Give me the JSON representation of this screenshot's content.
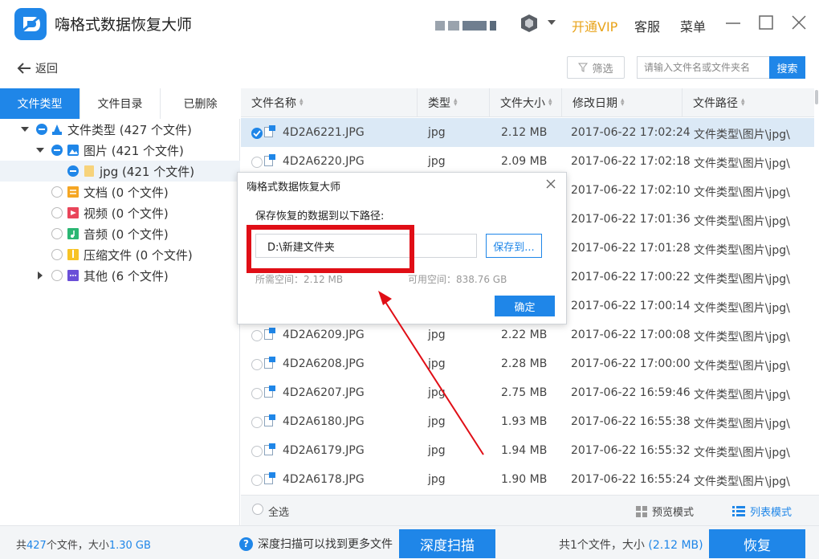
{
  "app": {
    "title": "嗨格式数据恢复大师",
    "vip_label": "开通VIP",
    "service_label": "客服",
    "menu_label": "菜单"
  },
  "toolbar": {
    "back_label": "返回",
    "filter_label": "筛选",
    "search_placeholder": "请输入文件名或文件夹名",
    "search_button": "搜索"
  },
  "left_tabs": [
    {
      "label": "文件类型",
      "active": true
    },
    {
      "label": "文件目录",
      "active": false
    },
    {
      "label": "已删除",
      "active": false
    }
  ],
  "tree": [
    {
      "label": "文件类型 (427 个文件)",
      "icon": "file-type-icon"
    },
    {
      "label": "图片 (421 个文件)",
      "icon": "image-icon"
    },
    {
      "label": "jpg (421 个文件)",
      "icon": "folder-icon"
    },
    {
      "label": "文档 (0 个文件)",
      "icon": "document-icon"
    },
    {
      "label": "视频 (0 个文件)",
      "icon": "video-icon"
    },
    {
      "label": "音频 (0 个文件)",
      "icon": "audio-icon"
    },
    {
      "label": "压缩文件 (0 个文件)",
      "icon": "archive-icon"
    },
    {
      "label": "其他 (6 个文件)",
      "icon": "other-icon"
    }
  ],
  "table": {
    "columns": [
      "文件名称",
      "类型",
      "文件大小",
      "修改日期",
      "文件路径"
    ],
    "rows": [
      {
        "name": "4D2A6221.JPG",
        "type": "jpg",
        "size": "2.12 MB",
        "date": "2017-06-22 17:02:24",
        "path": "文件类型\\图片\\jpg\\",
        "selected": true
      },
      {
        "name": "4D2A6220.JPG",
        "type": "jpg",
        "size": "2.09 MB",
        "date": "2017-06-22 17:02:18",
        "path": "文件类型\\图片\\jpg\\"
      },
      {
        "name": "",
        "type": "",
        "size": "",
        "date": "2017-06-22 17:02:10",
        "path": "文件类型\\图片\\jpg\\"
      },
      {
        "name": "",
        "type": "",
        "size": "",
        "date": "2017-06-22 17:01:36",
        "path": "文件类型\\图片\\jpg\\"
      },
      {
        "name": "",
        "type": "",
        "size": "",
        "date": "2017-06-22 17:01:28",
        "path": "文件类型\\图片\\jpg\\"
      },
      {
        "name": "",
        "type": "",
        "size": "",
        "date": "2017-06-22 17:00:22",
        "path": "文件类型\\图片\\jpg\\"
      },
      {
        "name": "",
        "type": "",
        "size": "",
        "date": "2017-06-22 17:00:14",
        "path": "文件类型\\图片\\jpg\\"
      },
      {
        "name": "4D2A6209.JPG",
        "type": "jpg",
        "size": "2.22 MB",
        "date": "2017-06-22 17:00:08",
        "path": "文件类型\\图片\\jpg\\"
      },
      {
        "name": "4D2A6208.JPG",
        "type": "jpg",
        "size": "2.28 MB",
        "date": "2017-06-22 17:00:00",
        "path": "文件类型\\图片\\jpg\\"
      },
      {
        "name": "4D2A6207.JPG",
        "type": "jpg",
        "size": "2.75 MB",
        "date": "2017-06-22 16:59:46",
        "path": "文件类型\\图片\\jpg\\"
      },
      {
        "name": "4D2A6180.JPG",
        "type": "jpg",
        "size": "1.93 MB",
        "date": "2017-06-22 16:55:38",
        "path": "文件类型\\图片\\jpg\\"
      },
      {
        "name": "4D2A6179.JPG",
        "type": "jpg",
        "size": "1.94 MB",
        "date": "2017-06-22 16:55:32",
        "path": "文件类型\\图片\\jpg\\"
      },
      {
        "name": "4D2A6178.JPG",
        "type": "jpg",
        "size": "1.90 MB",
        "date": "2017-06-22 16:55:24",
        "path": "文件类型\\图片\\jpg\\"
      }
    ]
  },
  "table_footer": {
    "select_all": "全选",
    "preview_mode": "预览模式",
    "list_mode": "列表模式"
  },
  "status": {
    "total_prefix": "共",
    "total_count": "427",
    "total_mid": "个文件，大小",
    "total_size": "1.30 GB",
    "hint": "深度扫描可以找到更多文件",
    "deep_scan_button": "深度扫描",
    "selected_prefix": "共1个文件，大小",
    "selected_size": "(2.12 MB)",
    "recover_button": "恢复"
  },
  "dialog": {
    "title": "嗨格式数据恢复大师",
    "prompt": "保存恢复的数据到以下路径:",
    "path_value": "D:\\新建文件夹",
    "save_to_button": "保存到...",
    "space_required": "所需空间：2.12 MB",
    "space_available": "可用空间：838.76 GB",
    "confirm_button": "确定"
  },
  "colors": {
    "accent": "#1f86e8",
    "vip": "#e8a319",
    "annotation": "#e00e16"
  }
}
